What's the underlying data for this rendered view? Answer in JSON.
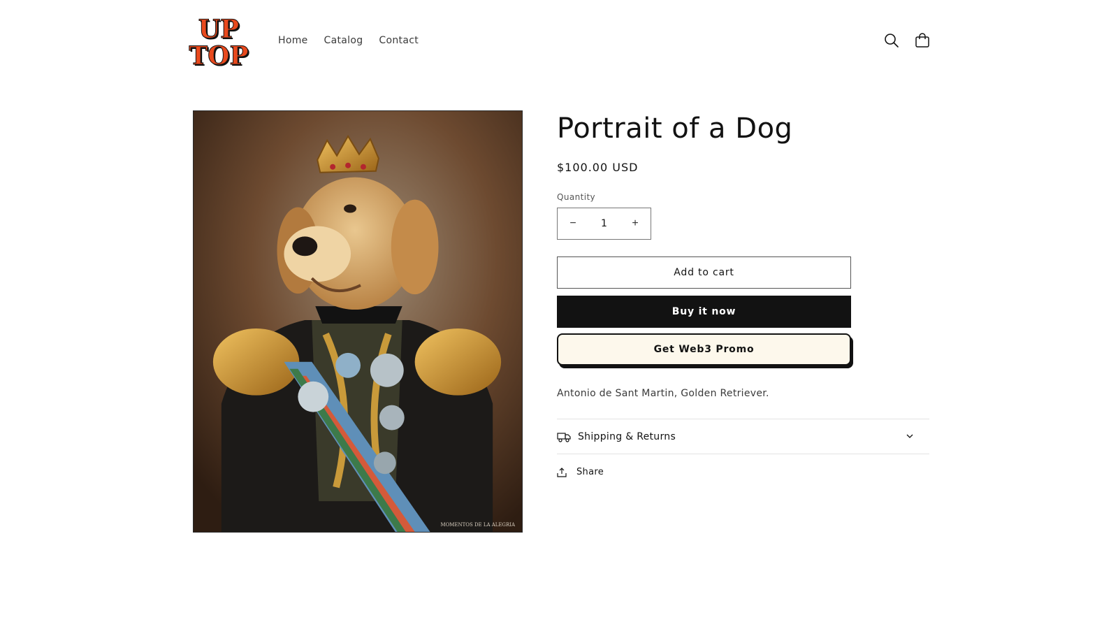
{
  "brand": {
    "logo_text": "UP TOP",
    "logo_line1": "UP",
    "logo_line2": "TOP",
    "logo_color": "#e8491d"
  },
  "nav": {
    "items": [
      "Home",
      "Catalog",
      "Contact"
    ]
  },
  "header_icons": {
    "search": "search-icon",
    "cart": "cart-icon"
  },
  "product": {
    "title": "Portrait of a Dog",
    "price": "$100.00 USD",
    "image_signature": "MOMENTOS DE LA ALEGRIA",
    "quantity_label": "Quantity",
    "quantity_value": "1",
    "decrease_symbol": "−",
    "increase_symbol": "+",
    "add_to_cart": "Add to cart",
    "buy_now": "Buy it now",
    "web3_promo": "Get Web3 Promo",
    "description": "Antonio de Sant Martin, Golden Retriever.",
    "shipping_label": "Shipping & Returns",
    "share_label": "Share"
  },
  "colors": {
    "buy_button_bg": "#121212",
    "web3_button_bg": "#fdf8ec",
    "text": "#121212"
  }
}
